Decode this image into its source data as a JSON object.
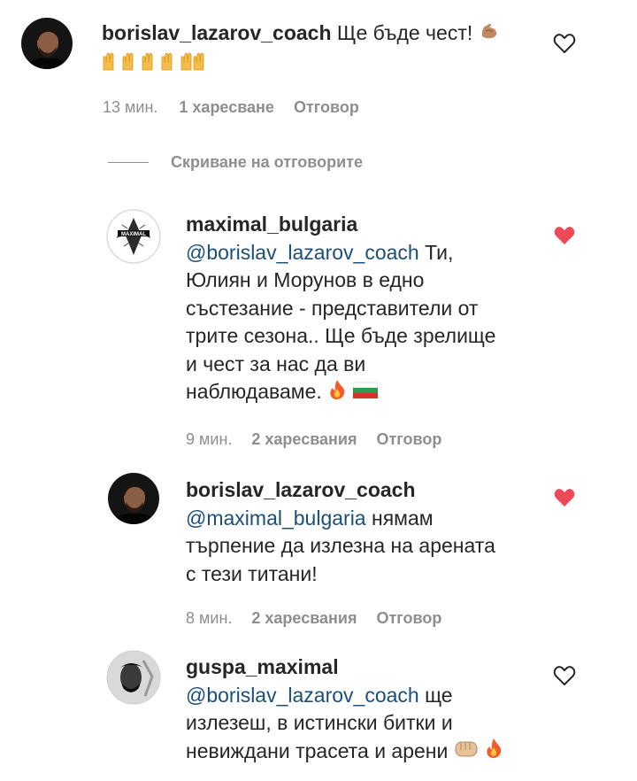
{
  "comments": [
    {
      "username": "borislav_lazarov_coach",
      "mention": "",
      "text": "Ще бъде чест!",
      "time": "13 мин.",
      "likes": "1 харесване",
      "reply": "Отговор",
      "liked": false,
      "emoji": [
        "flexed-biceps",
        "raised-hands",
        "raised-hands",
        "raised-hands",
        "raised-hands",
        "raised-hands"
      ]
    },
    {
      "username": "maximal_bulgaria",
      "mention": "@borislav_lazarov_coach",
      "text": "Ти,",
      "text_lines": [
        "Юлиян и Морунов в едно",
        "състезание - представители от",
        "трите сезона.. Ще бъде зрелище",
        "и чест за нас да ви",
        "наблюдаваме."
      ],
      "time": "9 мин.",
      "likes": "2 харесвания",
      "reply": "Отговор",
      "liked": true,
      "emoji": [
        "fire",
        "flag-bulgaria"
      ]
    },
    {
      "username": "borislav_lazarov_coach",
      "mention": "@maximal_bulgaria",
      "text": "нямам",
      "text_lines": [
        "търпение да излезна на арената",
        "с тези титани!"
      ],
      "time": "8 мин.",
      "likes": "2 харесвания",
      "reply": "Отговор",
      "liked": true,
      "emoji": []
    },
    {
      "username": "guspa_maximal",
      "mention": "@borislav_lazarov_coach",
      "text": "ще",
      "text_lines": [
        "излезеш, в истински битки и",
        "невиждани трасета и арени"
      ],
      "liked": false,
      "emoji": [
        "oncoming-fist",
        "fire"
      ]
    }
  ],
  "hide_replies_label": "Скриване на отговорите",
  "colors": {
    "mention": "#1a4f7a",
    "meta": "#8e8e8e",
    "heart_liked": "#ed4956",
    "text": "#262626"
  }
}
